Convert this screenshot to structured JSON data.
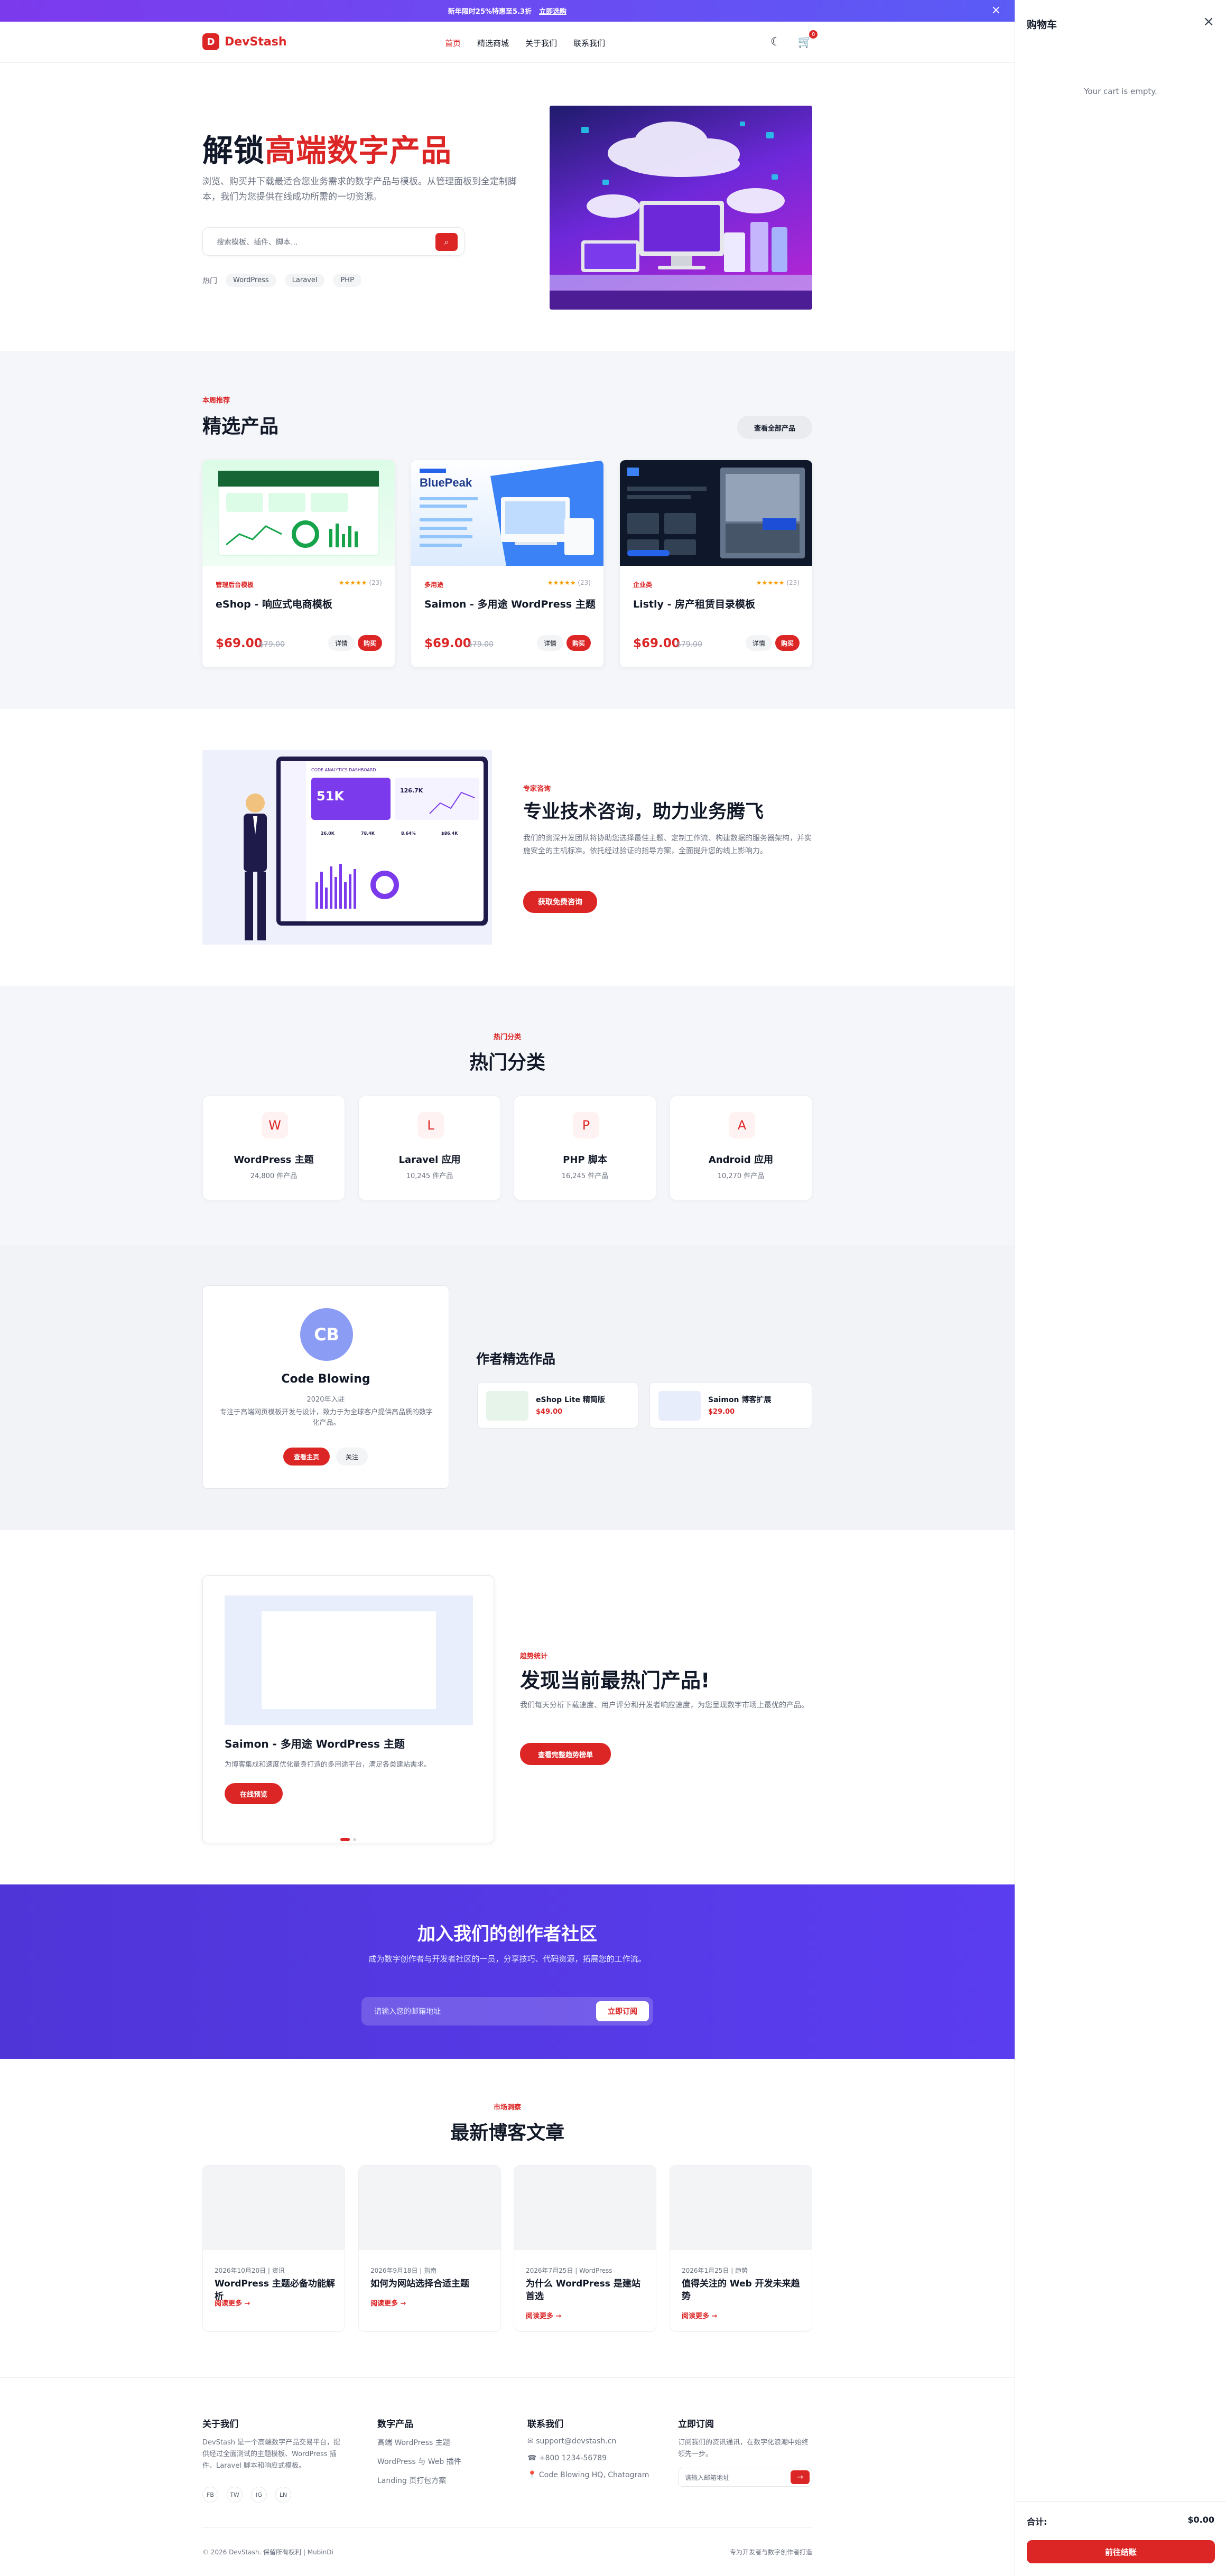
{
  "promo": {
    "text": "新年限时25%特惠至5.3折",
    "link": "立即选购"
  },
  "header": {
    "logo_mark": "D",
    "logo": "DevStash",
    "nav": [
      "首页",
      "精选商城",
      "关于我们",
      "联系我们"
    ],
    "cart_count": "0"
  },
  "hero": {
    "title_a": "解锁",
    "title_b": "高端数字产品",
    "subtitle": "浏览、购买并下载最适合您业务需求的数字产品与模板。从管理面板到全定制脚本，我们为您提供在线成功所需的一切资源。",
    "search_placeholder": "搜索模板、插件、脚本...",
    "hot_label": "热门",
    "hot_tags": [
      "WordPress",
      "Laravel",
      "PHP"
    ]
  },
  "featured": {
    "kicker": "本周推荐",
    "title": "精选产品",
    "view_all": "查看全部产品",
    "products": [
      {
        "category": "管理后台模板",
        "name": "eShop - 响应式电商模板",
        "price": "$69.00",
        "old_price": "$79.00",
        "stars": "★★★★★",
        "reviews": "(23)"
      },
      {
        "category": "多用途",
        "name": "Saimon - 多用途 WordPress 主题",
        "price": "$69.00",
        "old_price": "$79.00",
        "stars": "★★★★★",
        "reviews": "(23)"
      },
      {
        "category": "企业类",
        "name": "Listly - 房产租赁目录模板",
        "price": "$69.00",
        "old_price": "$79.00",
        "stars": "★★★★★",
        "reviews": "(23)"
      }
    ],
    "details": "详情",
    "buy": "购买"
  },
  "consult": {
    "kicker": "专家咨询",
    "title": "专业技术咨询，助力业务腾飞",
    "text": "我们的资深开发团队将协助您选择最佳主题、定制工作流、构建数据的服务器架构，并实施安全的主机标准。依托经过验证的指导方案，全面提升您的线上影响力。",
    "button": "获取免费咨询",
    "dash": {
      "brand": "CODE ANALYTICS DASHBOARD",
      "big": "51K",
      "stat2": "126.7K",
      "m1": "26.0K",
      "m2": "78.4K",
      "m3": "8.64%",
      "m4": "$86.4K"
    }
  },
  "categories": {
    "kicker": "热门分类",
    "title": "热门分类",
    "items": [
      {
        "icon": "W",
        "name": "WordPress 主题",
        "count": "24,800 件产品"
      },
      {
        "icon": "L",
        "name": "Laravel 应用",
        "count": "10,245 件产品"
      },
      {
        "icon": "P",
        "name": "PHP 脚本",
        "count": "16,245 件产品"
      },
      {
        "icon": "A",
        "name": "Android 应用",
        "count": "10,270 件产品"
      }
    ]
  },
  "author": {
    "initials": "CB",
    "name": "Code Blowing",
    "since": "2020年入驻",
    "bio": "专注于高端网页模板开发与设计，致力于为全球客户提供高品质的数字化产品。",
    "view": "查看主页",
    "follow": "关注",
    "works_title": "作者精选作品",
    "works": [
      {
        "name": "eShop Lite 精简版",
        "price": "$49.00"
      },
      {
        "name": "Saimon 博客扩展",
        "price": "$29.00"
      }
    ]
  },
  "trend": {
    "product_name": "Saimon - 多用途 WordPress 主题",
    "product_desc": "为博客集成和速度优化量身打造的多用途平台，满足各类建站需求。",
    "preview": "在线预览",
    "kicker": "趋势统计",
    "title": "发现当前最热门产品!",
    "text": "我们每天分析下载速度、用户评分和开发者响应速度，为您呈现数字市场上最优的产品。",
    "button": "查看完整趋势榜单"
  },
  "community": {
    "title": "加入我们的创作者社区",
    "text": "成为数字创作者与开发者社区的一员，分享技巧、代码资源，拓展您的工作流。",
    "placeholder": "请输入您的邮箱地址",
    "button": "立即订阅"
  },
  "blog": {
    "kicker": "市场洞察",
    "title": "最新博客文章",
    "more": "阅读更多 →",
    "posts": [
      {
        "meta": "2026年10月20日 | 资讯",
        "title": "WordPress 主题必备功能解析"
      },
      {
        "meta": "2026年9月18日 | 指南",
        "title": "如何为网站选择合适主题"
      },
      {
        "meta": "2026年7月25日 | WordPress",
        "title": "为什么 WordPress 是建站首选"
      },
      {
        "meta": "2026年1月25日 | 趋势",
        "title": "值得关注的 Web 开发未来趋势"
      }
    ]
  },
  "footer": {
    "about_title": "关于我们",
    "about_text": "DevStash 是一个高端数字产品交易平台，提供经过全面测试的主题模板、WordPress 插件、Laravel 脚本和响应式模板。",
    "social": [
      "FB",
      "TW",
      "IG",
      "LN"
    ],
    "products_title": "数字产品",
    "products": [
      "高端 WordPress 主题",
      "WordPress 与 Web 插件",
      "Landing 页打包方案"
    ],
    "contact_title": "联系我们",
    "contact": [
      "✉ support@devstash.cn",
      "☎ +800 1234-56789",
      "📍 Code Blowing HQ, Chatogram"
    ],
    "sub_title": "立即订阅",
    "sub_text": "订阅我们的资讯通讯，在数字化浪潮中始终领先一步。",
    "sub_placeholder": "请输入邮箱地址",
    "sub_btn": "→",
    "copyright": "© 2026 DevStash. 保留所有权利 | MubinDi",
    "right": "专为开发者与数字创作者打造"
  },
  "cart": {
    "title": "购物车",
    "empty": "Your cart is empty.",
    "total_label": "合计:",
    "total": "$0.00",
    "checkout": "前往结账"
  },
  "colors": {
    "accent": "#dc2626",
    "community_bg": "#5b3df0",
    "drawer_bg": "#ffffff"
  }
}
